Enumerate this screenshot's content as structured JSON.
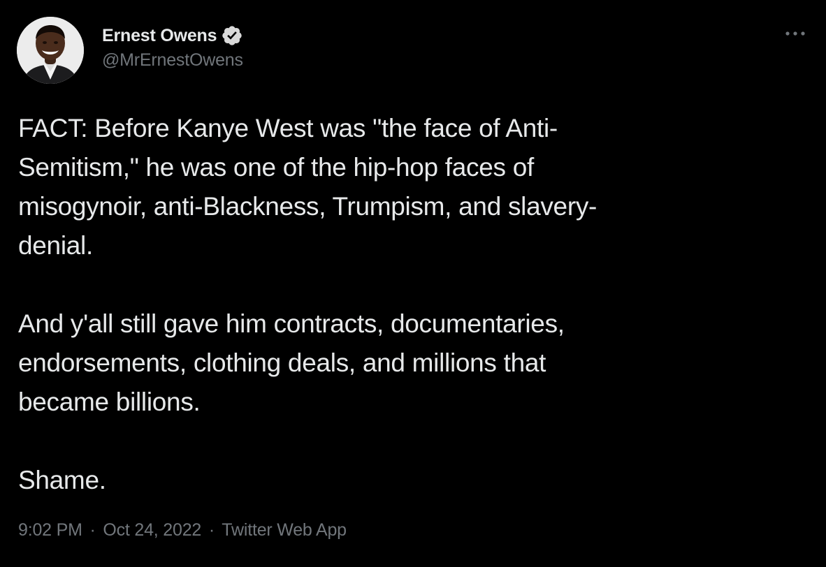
{
  "author": {
    "display_name": "Ernest Owens",
    "handle": "@MrErnestOwens",
    "verified": true
  },
  "tweet": {
    "paragraphs": [
      "FACT: Before Kanye West was \"the face of Anti-\nSemitism,\" he was one of the hip-hop faces of\nmisogynoir, anti-Blackness, Trumpism, and slavery-\ndenial.",
      "And y'all still gave him contracts, documentaries,\nendorsements, clothing deals, and millions that\nbecame billions.",
      "Shame."
    ],
    "time": "9:02 PM",
    "separator": "·",
    "date": "Oct 24, 2022",
    "source": "Twitter Web App"
  },
  "icons": {
    "verified": "verified-badge-icon",
    "more": "more-options-icon"
  },
  "colors": {
    "background": "#000000",
    "text_primary": "#e7e9ea",
    "text_secondary": "#71767b"
  }
}
